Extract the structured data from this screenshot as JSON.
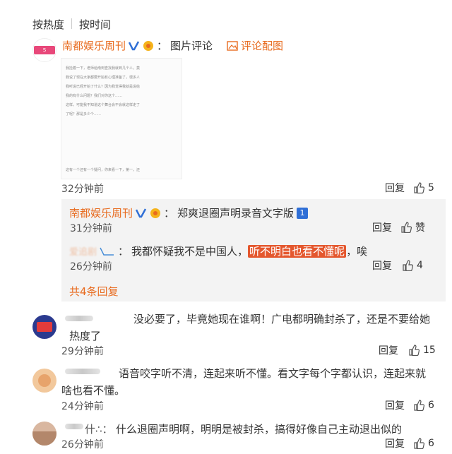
{
  "sort": {
    "by_hot": "按热度",
    "by_time": "按时间"
  },
  "post": {
    "author": "南都娱乐周刊",
    "colon": "：",
    "caption": "图片评论",
    "view_image": "评论配图",
    "time": "32分钟前",
    "reply_label": "回复",
    "like_count": "5",
    "image_lines": [
      "我捡着一下，老师给南到查找我就到几个人，莫",
      "我说了现在大家都要开始有心理准备了，很多人",
      "我听说已经开始了什么？因为我觉得我就是说给",
      "我的有什么问题？我们对你这个……",
      "这样，可能我不知道这个舞台会不会就这样走了",
      "了呢？那是多少个……"
    ],
    "image_footer": "这有一个还有一个疑问，你来看一下，第一，还"
  },
  "replies": [
    {
      "author": "南都娱乐周刊",
      "colon": "：",
      "text": "郑爽退圈声明录音文字版",
      "badge": "1",
      "time": "31分钟前",
      "reply_label": "回复",
      "like_label": "赞"
    },
    {
      "author": "爱追剧",
      "colon": "：",
      "text_before": "我都怀疑我不是中国人，",
      "highlight": "听不明白也看不懂呢",
      "text_after": "，唉",
      "time": "26分钟前",
      "reply_label": "回复",
      "like_count": "4"
    }
  ],
  "more_replies": "共4条回复",
  "comments": [
    {
      "text_line1": "没必要了，毕竟她现在谁啊！广电都明确封杀了，还是不要给她",
      "text_line2": "热度了",
      "time": "29分钟前",
      "reply_label": "回复",
      "like_count": "15"
    },
    {
      "text_line1": "语音咬字听不清，连起来听不懂。看文字每个字都认识，连起来就",
      "text_line2": "啥也看不懂。",
      "time": "24分钟前",
      "reply_label": "回复",
      "like_count": "6"
    },
    {
      "prefix": "什∴：",
      "text_line1": "什么退圈声明啊，明明是被封杀，搞得好像自己主动退出似的",
      "time": "26分钟前",
      "reply_label": "回复",
      "like_count": "6"
    }
  ],
  "colors": {
    "accent": "#e86b1f",
    "highlight": "#e4572e",
    "badge_blue": "#2f6fd6"
  }
}
